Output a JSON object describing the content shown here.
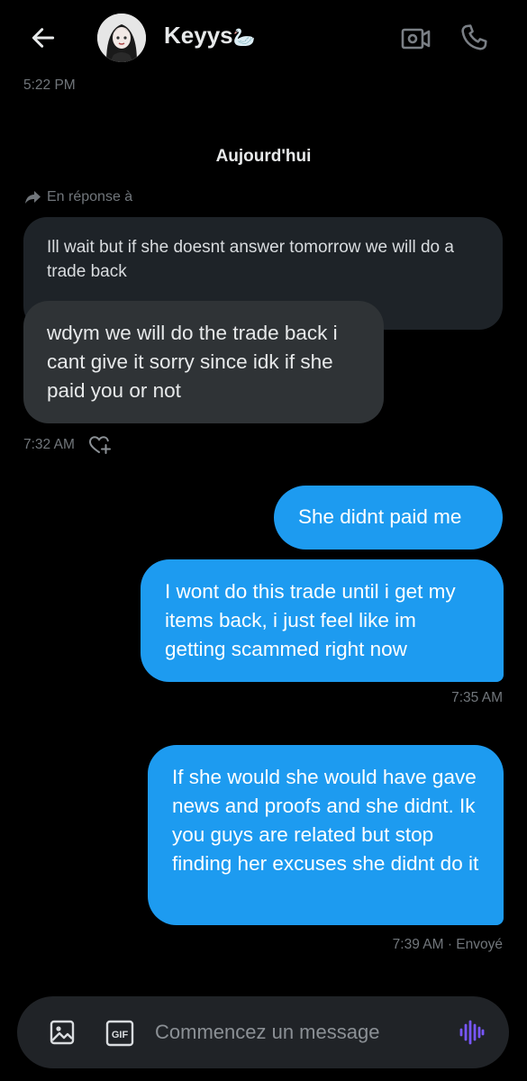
{
  "header": {
    "contact_name": "Keyys",
    "name_emoji": "🦢",
    "back_icon": "arrow-left-icon",
    "video_icon": "video-camera-icon",
    "call_icon": "phone-icon"
  },
  "conversation": {
    "previous_time": "5:22 PM",
    "day_separator": "Aujourd'hui",
    "reply_label": "En réponse à",
    "quoted_text": "Ill wait but if she doesnt answer tomorrow we will do a trade back",
    "received": [
      {
        "text": "wdym we will do the trade back i cant give it sorry since idk if she paid you or not",
        "time": "7:32 AM"
      }
    ],
    "sent": [
      {
        "text": "She didnt paid me"
      },
      {
        "text": "I wont do this trade until i get my items back, i just feel like im getting scammed right now",
        "time": "7:35 AM"
      },
      {
        "text": "If she would she would have gave news and proofs and  she didnt. Ik you guys are related but stop finding her excuses she didnt do it",
        "time": "7:39 AM · Envoyé"
      }
    ]
  },
  "composer": {
    "placeholder": "Commencez un message",
    "value": "",
    "gif_label": "GIF",
    "accent_color": "#7856ff"
  },
  "colors": {
    "background": "#000000",
    "sent_bubble": "#1d9bf0",
    "received_bubble": "#2f3336",
    "meta_text": "#71767b"
  }
}
